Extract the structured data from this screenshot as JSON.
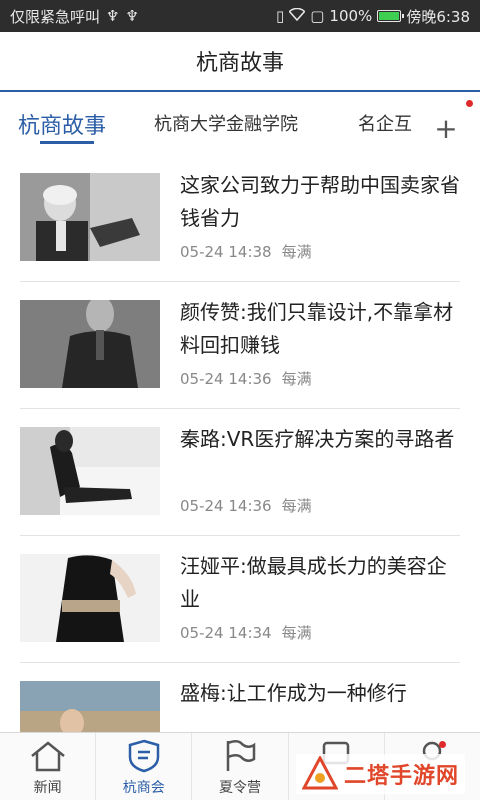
{
  "status_bar": {
    "left_text": "仅限紧急呼叫",
    "battery": "100%",
    "battery_level": 1.0,
    "time": "傍晚6:38",
    "icons": [
      "usb-icon",
      "usb-icon",
      "vibrate-icon",
      "wifi-icon",
      "sim-icon",
      "battery-icon"
    ]
  },
  "header": {
    "title": "杭商故事"
  },
  "tabs": {
    "items": [
      {
        "label": "杭商故事",
        "active": true
      },
      {
        "label": "杭商大学金融学院",
        "active": false
      },
      {
        "label": "名企互",
        "active": false
      }
    ],
    "add_icon": "plus-icon"
  },
  "articles": [
    {
      "title": "这家公司致力于帮助中国卖家省钱省力",
      "date": "05-24 14:38",
      "source": "每满"
    },
    {
      "title": "颜传赞:我们只靠设计,不靠拿材料回扣赚钱",
      "date": "05-24 14:36",
      "source": "每满"
    },
    {
      "title": "秦路:VR医疗解决方案的寻路者",
      "date": "05-24 14:36",
      "source": "每满"
    },
    {
      "title": "汪娅平:做最具成长力的美容企业",
      "date": "05-24 14:34",
      "source": "每满"
    },
    {
      "title": "盛梅:让工作成为一种修行",
      "date": "",
      "source": ""
    }
  ],
  "bottom_nav": {
    "items": [
      {
        "label": "新闻",
        "icon": "home-icon",
        "active": false
      },
      {
        "label": "杭商会",
        "icon": "shield-icon",
        "active": true
      },
      {
        "label": "夏令营",
        "icon": "flag-icon",
        "active": false
      },
      {
        "label": "",
        "icon": "chat-icon",
        "active": false
      },
      {
        "label": "",
        "icon": "user-icon",
        "active": false
      }
    ]
  },
  "watermark": {
    "text": "二塔手游网"
  },
  "colors": {
    "accent": "#2b5ea6",
    "badge": "#e02a2a",
    "status_bar": "#2d2d2d",
    "battery": "#3ecf52"
  }
}
